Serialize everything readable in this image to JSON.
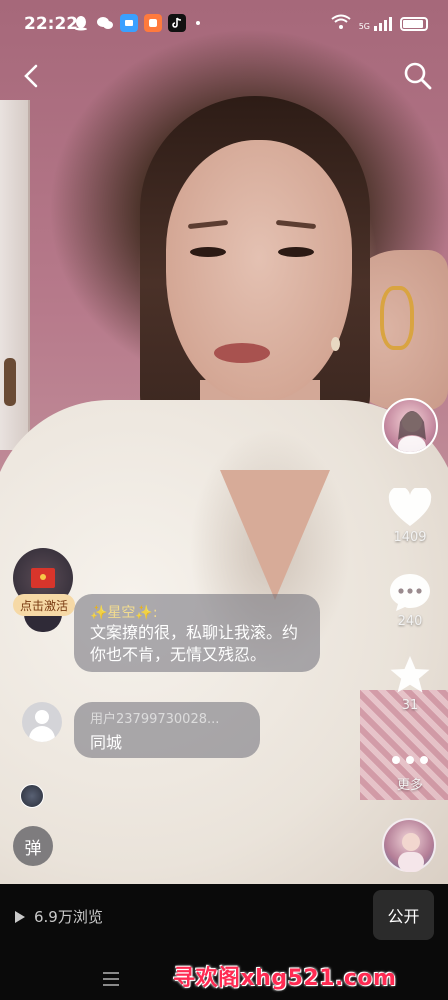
{
  "status_bar": {
    "time": "22:22",
    "signal": "5G"
  },
  "nav": {
    "back_icon": "chevron-left-icon",
    "search_icon": "search-icon"
  },
  "right_rail": {
    "likes": "1409",
    "comments": "240",
    "favorites": "31",
    "more": "更多"
  },
  "red_envelope": {
    "label": "点击激活"
  },
  "comments": [
    {
      "name": "✨星空✨:",
      "text": "文案撩的很，私聊让我滚。约你也不肯，无情又残忍。"
    },
    {
      "name": "用户23799730028...",
      "text": "同城"
    }
  ],
  "danmu_button": "弹",
  "bottom_bar": {
    "views": "6.9万浏览",
    "public_button": "公开",
    "watermark": "寻欢阁xhg521.com"
  },
  "colors": {
    "watermark": "#ff2b52",
    "activate_pill": "#f6d9a6"
  }
}
